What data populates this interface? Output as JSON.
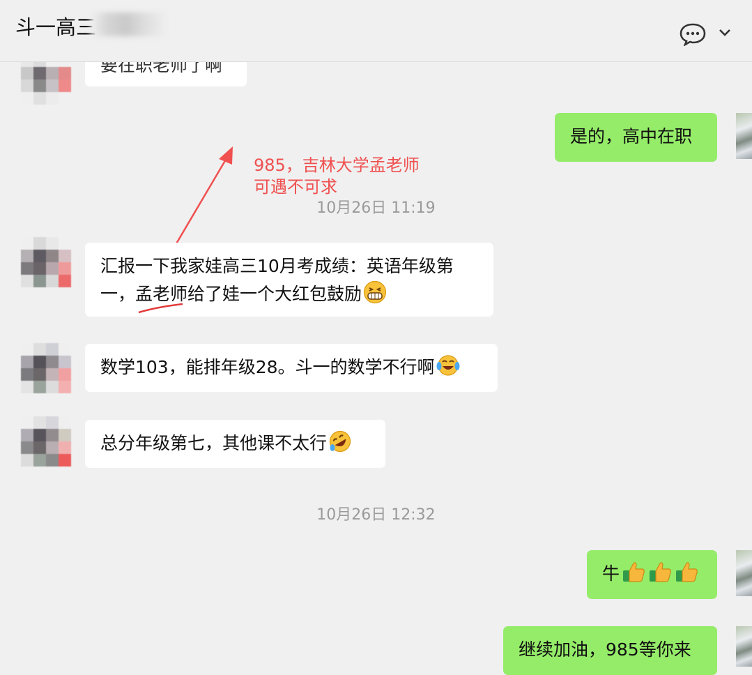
{
  "header": {
    "chat_title": "斗一高三"
  },
  "timestamps": [
    "10月26日 11:19",
    "10月26日 12:32"
  ],
  "annotation": {
    "line1": "985，吉林大学孟老师",
    "line2": "可遇不可求",
    "color": "#f05050"
  },
  "messages": [
    {
      "side": "in",
      "text": "要在职老师了啊"
    },
    {
      "side": "out",
      "text": "是的，高中在职"
    },
    {
      "side": "in",
      "text_a": "汇报一下我家娃高三10月考成绩：英语年级第",
      "text_b": "一，孟老师给了娃一个大红包鼓励",
      "emoji": "grin-emoji"
    },
    {
      "side": "in",
      "text": "数学103，能排年级28。斗一的数学不行啊",
      "emoji": "tears-of-joy-emoji"
    },
    {
      "side": "in",
      "text": "总分年级第七，其他课不太行",
      "emoji": "rolling-laughing-emoji"
    },
    {
      "side": "out",
      "text": "牛",
      "emoji": "thumbs-up-emoji x3"
    },
    {
      "side": "out",
      "text": "继续加油，985等你来"
    }
  ],
  "colors": {
    "background": "#f0f0f0",
    "incoming_bubble": "#ffffff",
    "outgoing_bubble": "#95ec69",
    "timestamp_text": "#9a9a9a"
  },
  "icons": [
    "chat-bubble-icon",
    "chevron-down-icon"
  ]
}
